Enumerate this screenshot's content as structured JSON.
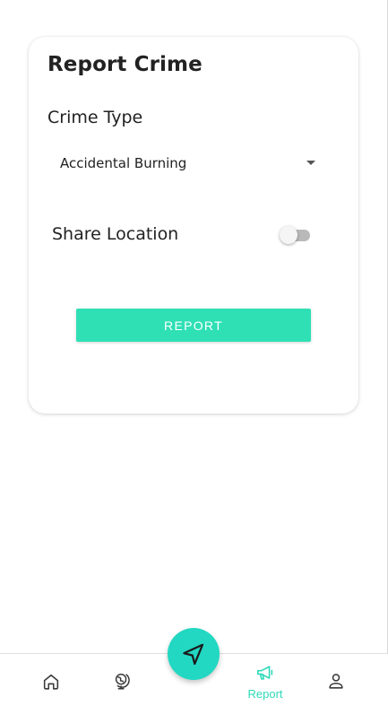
{
  "report_card": {
    "title": "Report Crime",
    "crime_type_label": "Crime Type",
    "crime_type_selected": "Accidental Burning",
    "share_location_label": "Share Location",
    "share_location_enabled": false,
    "submit_label": "REPORT"
  },
  "bottom_nav": {
    "items": [
      {
        "icon": "home-icon",
        "label": ""
      },
      {
        "icon": "globe-icon",
        "label": ""
      },
      {
        "icon": "megaphone-icon",
        "label": "Report",
        "active": true
      },
      {
        "icon": "user-icon",
        "label": ""
      }
    ],
    "fab_icon": "navigation-arrow-icon"
  },
  "colors": {
    "accent": "#2fe0b5",
    "fab": "#22d8c2",
    "active_nav": "#2ed9b8",
    "toggle_off_track": "#b9b9b9"
  }
}
